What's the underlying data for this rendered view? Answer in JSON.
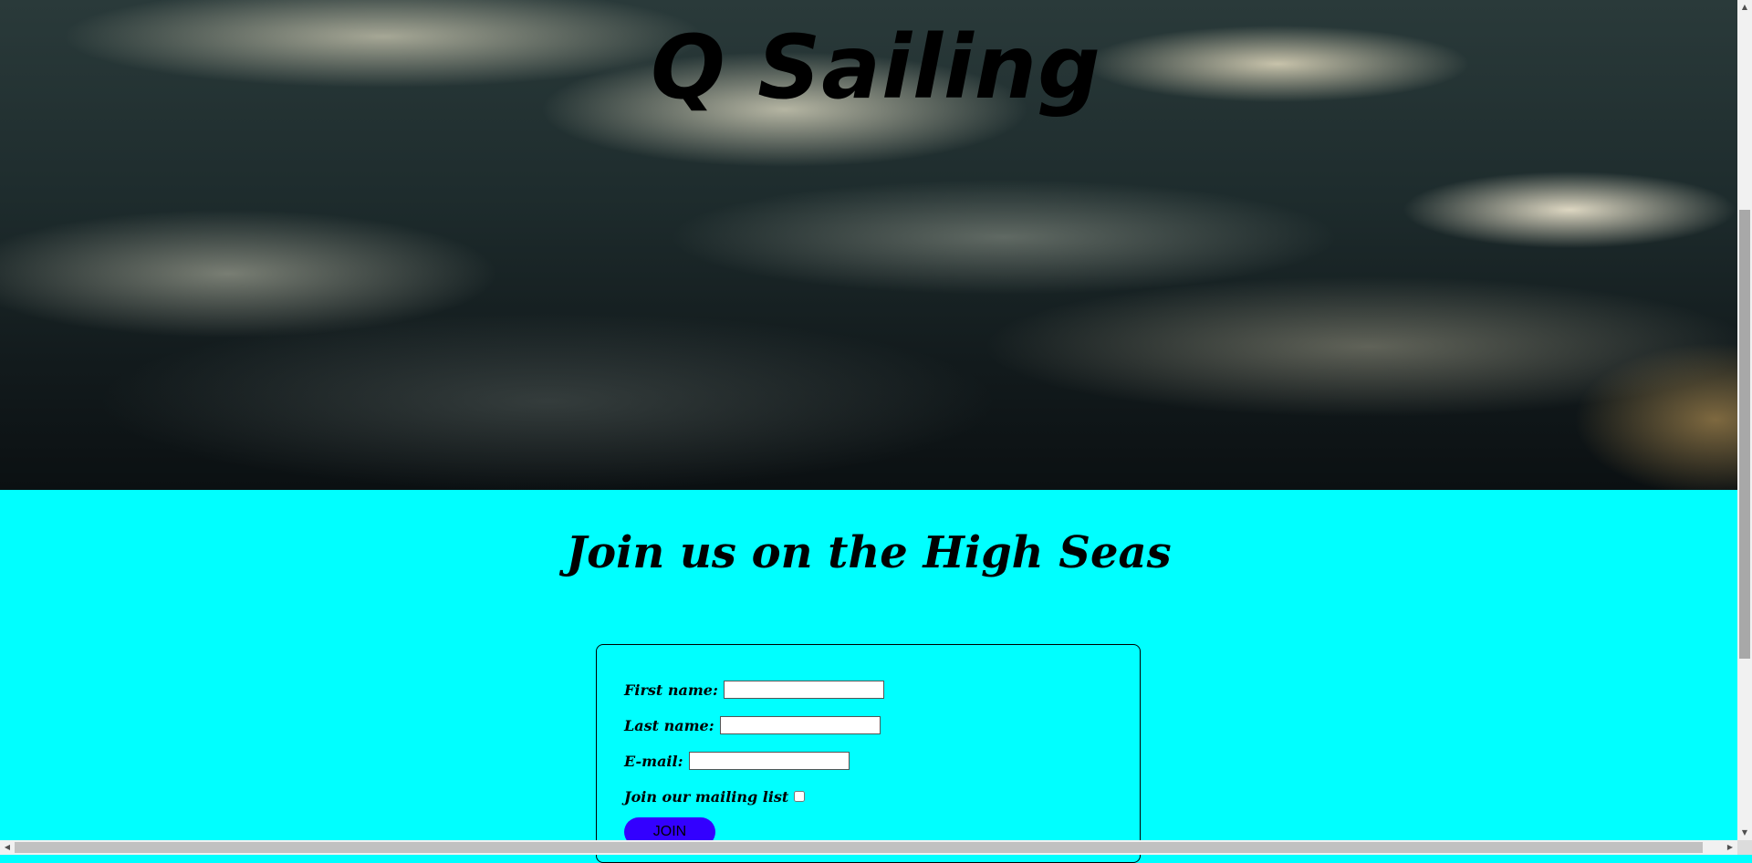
{
  "site_title": "Q Sailing",
  "headline": "Join us on the High Seas",
  "form": {
    "first_name_label": "First name:",
    "last_name_label": "Last name:",
    "email_label": "E-mail:",
    "mailing_list_label": "Join our mailing list",
    "first_name_value": "",
    "last_name_value": "",
    "email_value": "",
    "mailing_list_checked": false,
    "submit_label": "JOIN"
  },
  "colors": {
    "page_background": "#00ffff",
    "button_background": "#3300ff"
  },
  "icons": {
    "scroll_up": "▲",
    "scroll_down": "▼",
    "scroll_left": "◀",
    "scroll_right": "▶"
  }
}
